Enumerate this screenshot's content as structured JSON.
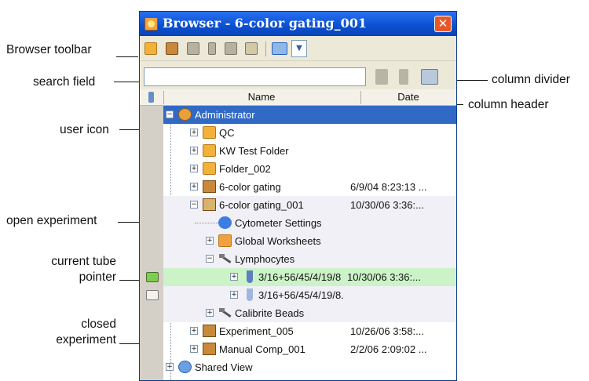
{
  "window": {
    "title": "Browser - 6-color gating_001",
    "close_label": "✕"
  },
  "header": {
    "name": "Name",
    "date": "Date"
  },
  "callouts": {
    "browser_toolbar": "Browser toolbar",
    "search_field": "search field",
    "user_icon": "user icon",
    "open_experiment": "open experiment",
    "current_tube_1": "current tube",
    "current_tube_2": "pointer",
    "closed_1": "closed",
    "closed_2": "experiment",
    "column_divider": "column divider",
    "column_header": "column header"
  },
  "tree": [
    {
      "label": "Administrator",
      "date": ""
    },
    {
      "label": "QC",
      "date": ""
    },
    {
      "label": "KW Test Folder",
      "date": ""
    },
    {
      "label": "Folder_002",
      "date": ""
    },
    {
      "label": "6-color gating",
      "date": "6/9/04 8:23:13 ..."
    },
    {
      "label": "6-color gating_001",
      "date": "10/30/06 3:36:..."
    },
    {
      "label": "Cytometer Settings",
      "date": ""
    },
    {
      "label": "Global Worksheets",
      "date": ""
    },
    {
      "label": "Lymphocytes",
      "date": ""
    },
    {
      "label": "3/16+56/45/4/19/8",
      "date": "10/30/06 3:36:..."
    },
    {
      "label": "3/16+56/45/4/19/8.",
      "date": ""
    },
    {
      "label": "Calibrite Beads",
      "date": ""
    },
    {
      "label": "Experiment_005",
      "date": "10/26/06 3:58:..."
    },
    {
      "label": "Manual Comp_001",
      "date": "2/2/06 2:09:02 ..."
    },
    {
      "label": "Shared View",
      "date": ""
    }
  ],
  "icons": {
    "toolbar": [
      "new-folder-icon",
      "new-experiment-icon",
      "new-specimen-icon",
      "new-tube-icon",
      "new-worksheet-icon",
      "properties-icon",
      "export-icon"
    ],
    "search": [
      "search-prev-icon",
      "search-next-icon",
      "search-clear-icon"
    ]
  }
}
